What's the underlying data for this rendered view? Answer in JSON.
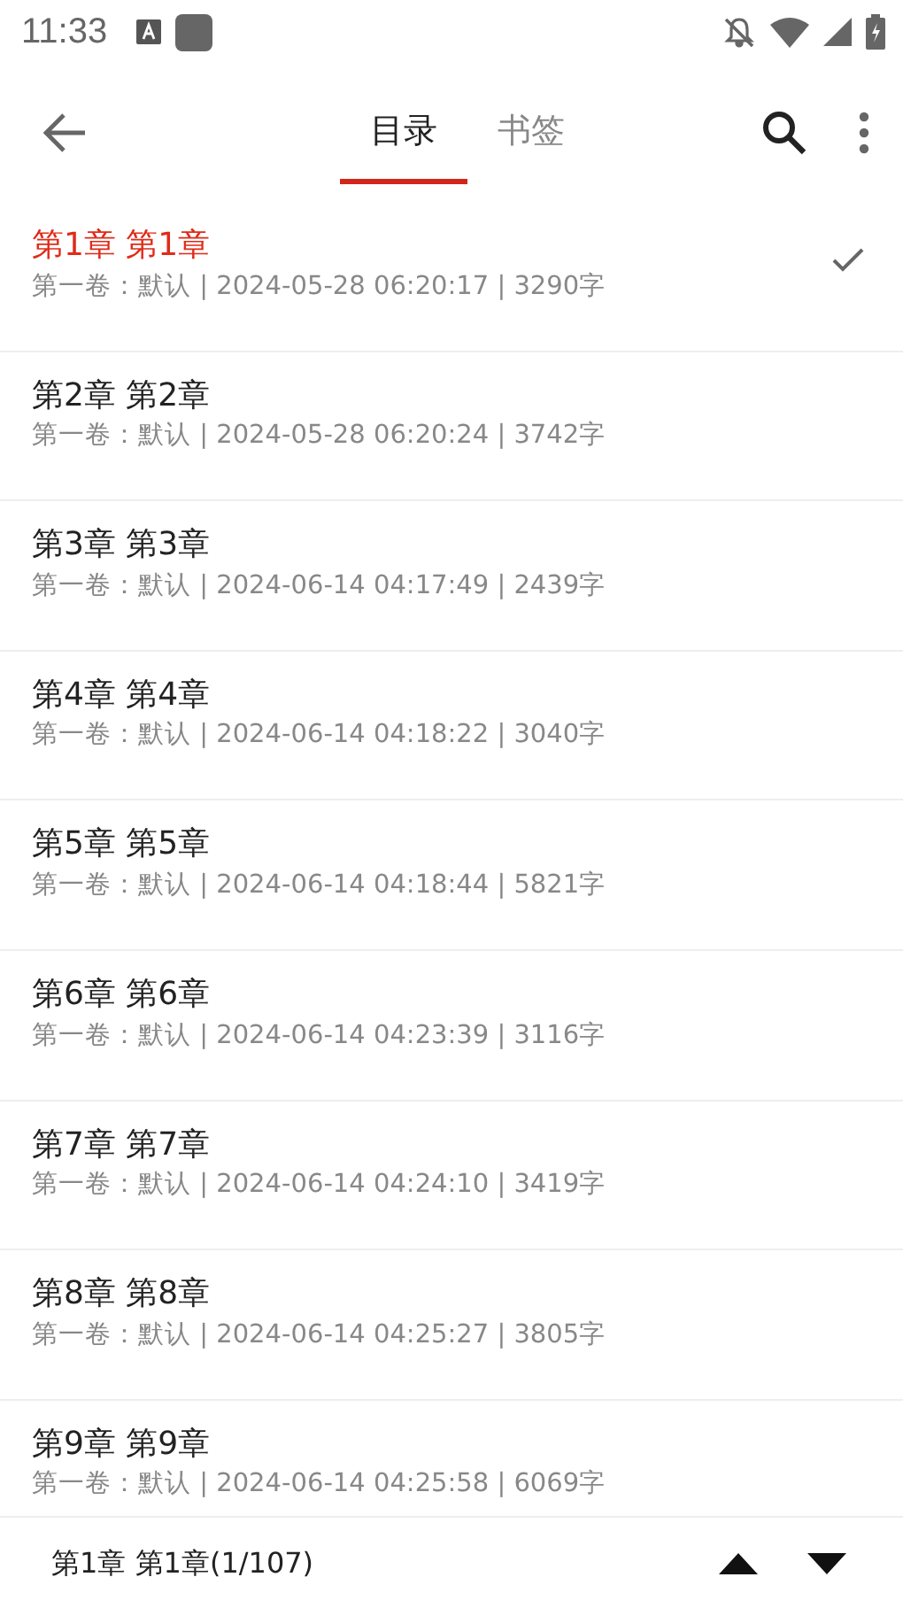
{
  "status_bar": {
    "time": "11:33"
  },
  "tabs": [
    {
      "label": "目录",
      "selected": true
    },
    {
      "label": "书签",
      "selected": false
    }
  ],
  "chapters": [
    {
      "title": "第1章 第1章",
      "info": "第一卷：默认 | 2024-05-28 06:20:17 | 3290字",
      "selected": true
    },
    {
      "title": "第2章 第2章",
      "info": "第一卷：默认 | 2024-05-28 06:20:24 | 3742字",
      "selected": false
    },
    {
      "title": "第3章 第3章",
      "info": "第一卷：默认 | 2024-06-14 04:17:49 | 2439字",
      "selected": false
    },
    {
      "title": "第4章 第4章",
      "info": "第一卷：默认 | 2024-06-14 04:18:22 | 3040字",
      "selected": false
    },
    {
      "title": "第5章 第5章",
      "info": "第一卷：默认 | 2024-06-14 04:18:44 | 5821字",
      "selected": false
    },
    {
      "title": "第6章 第6章",
      "info": "第一卷：默认 | 2024-06-14 04:23:39 | 3116字",
      "selected": false
    },
    {
      "title": "第7章 第7章",
      "info": "第一卷：默认 | 2024-06-14 04:24:10 | 3419字",
      "selected": false
    },
    {
      "title": "第8章 第8章",
      "info": "第一卷：默认 | 2024-06-14 04:25:27 | 3805字",
      "selected": false
    },
    {
      "title": "第9章 第9章",
      "info": "第一卷：默认 | 2024-06-14 04:25:58 | 6069字",
      "selected": false
    }
  ],
  "footer": {
    "current": "第1章 第1章(1/107)"
  }
}
